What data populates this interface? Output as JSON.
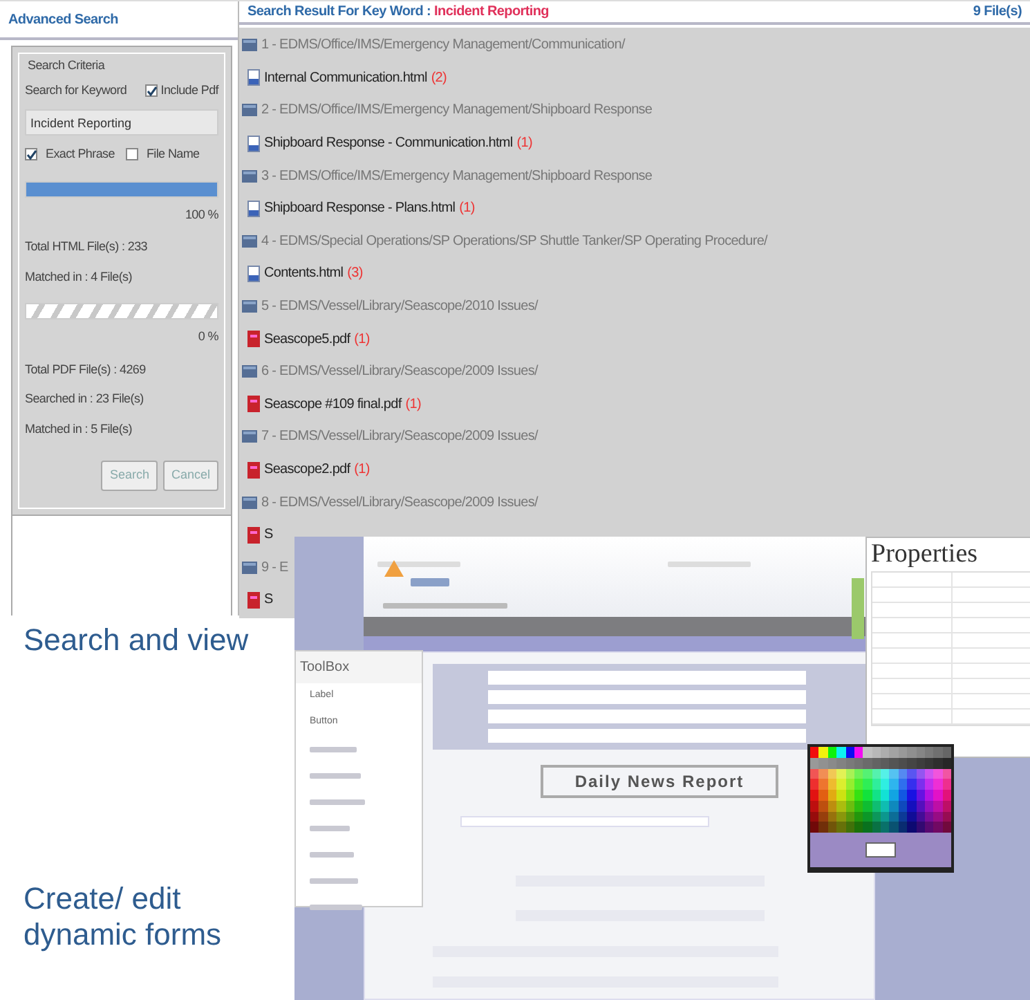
{
  "search_panel": {
    "title": "Advanced Search",
    "legend": "Search Criteria",
    "keyword_label": "Search for Keyword",
    "include_pdf": {
      "label": "Include Pdf",
      "checked": true
    },
    "keyword_value": "Incident Reporting",
    "exact_phrase": {
      "label": "Exact Phrase",
      "checked": true
    },
    "file_name": {
      "label": "File Name",
      "checked": false
    },
    "html_progress": {
      "level": 1,
      "reading": "100 %"
    },
    "html_stats": [
      "Total HTML File(s) : 233",
      "Matched in : 4 File(s)"
    ],
    "pdf_progress": {
      "level": 0,
      "reading": "0 %"
    },
    "pdf_stats": [
      "Total PDF File(s) : 4269",
      "Searched in : 23 File(s)",
      "Matched in : 5 File(s)"
    ],
    "buttons": [
      "Search",
      "Cancel"
    ]
  },
  "results": {
    "title": "Search Result For Key Word : ",
    "keyword": "Incident Reporting",
    "count": "9 File(s)",
    "rows": [
      {
        "kind": "folder",
        "text": "1 - EDMS/Office/IMS/Emergency Management/Communication/"
      },
      {
        "kind": "html_file",
        "text": "Internal Communication.html",
        "hits": "(2)"
      },
      {
        "kind": "folder",
        "text": "2 - EDMS/Office/IMS/Emergency Management/Shipboard Response"
      },
      {
        "kind": "html_file",
        "text": "Shipboard Response - Communication.html",
        "hits": "(1)"
      },
      {
        "kind": "folder",
        "text": "3 - EDMS/Office/IMS/Emergency Management/Shipboard Response"
      },
      {
        "kind": "html_file",
        "text": "Shipboard Response - Plans.html",
        "hits": "(1)"
      },
      {
        "kind": "folder",
        "text": "4 - EDMS/Special Operations/SP Operations/SP Shuttle Tanker/SP Operating Procedure/"
      },
      {
        "kind": "html_file",
        "text": "Contents.html",
        "hits": "(3)"
      },
      {
        "kind": "folder",
        "text": "5 - EDMS/Vessel/Library/Seascope/2010 Issues/"
      },
      {
        "kind": "pdf_file",
        "text": "Seascope5.pdf",
        "hits": "(1)"
      },
      {
        "kind": "folder",
        "text": "6 - EDMS/Vessel/Library/Seascope/2009 Issues/"
      },
      {
        "kind": "pdf_file",
        "text": "Seascope #109 final.pdf",
        "hits": "(1)"
      },
      {
        "kind": "folder",
        "text": "7 - EDMS/Vessel/Library/Seascope/2009 Issues/"
      },
      {
        "kind": "pdf_file",
        "text": "Seascope2.pdf",
        "hits": "(1)"
      },
      {
        "kind": "folder",
        "text": "8 - EDMS/Vessel/Library/Seascope/2009 Issues/"
      },
      {
        "kind": "pdf_file",
        "text": "S"
      },
      {
        "kind": "folder",
        "text": "9 - E"
      },
      {
        "kind": "pdf_file",
        "text": "S"
      }
    ]
  },
  "captions": [
    "Search and view",
    "Create/ edit dynamic forms"
  ],
  "form_designer": {
    "properties_title": "Properties",
    "toolbox_title": "ToolBox",
    "toolbox_items": [
      "Label",
      "Button"
    ],
    "form_title": "Daily News Report"
  }
}
